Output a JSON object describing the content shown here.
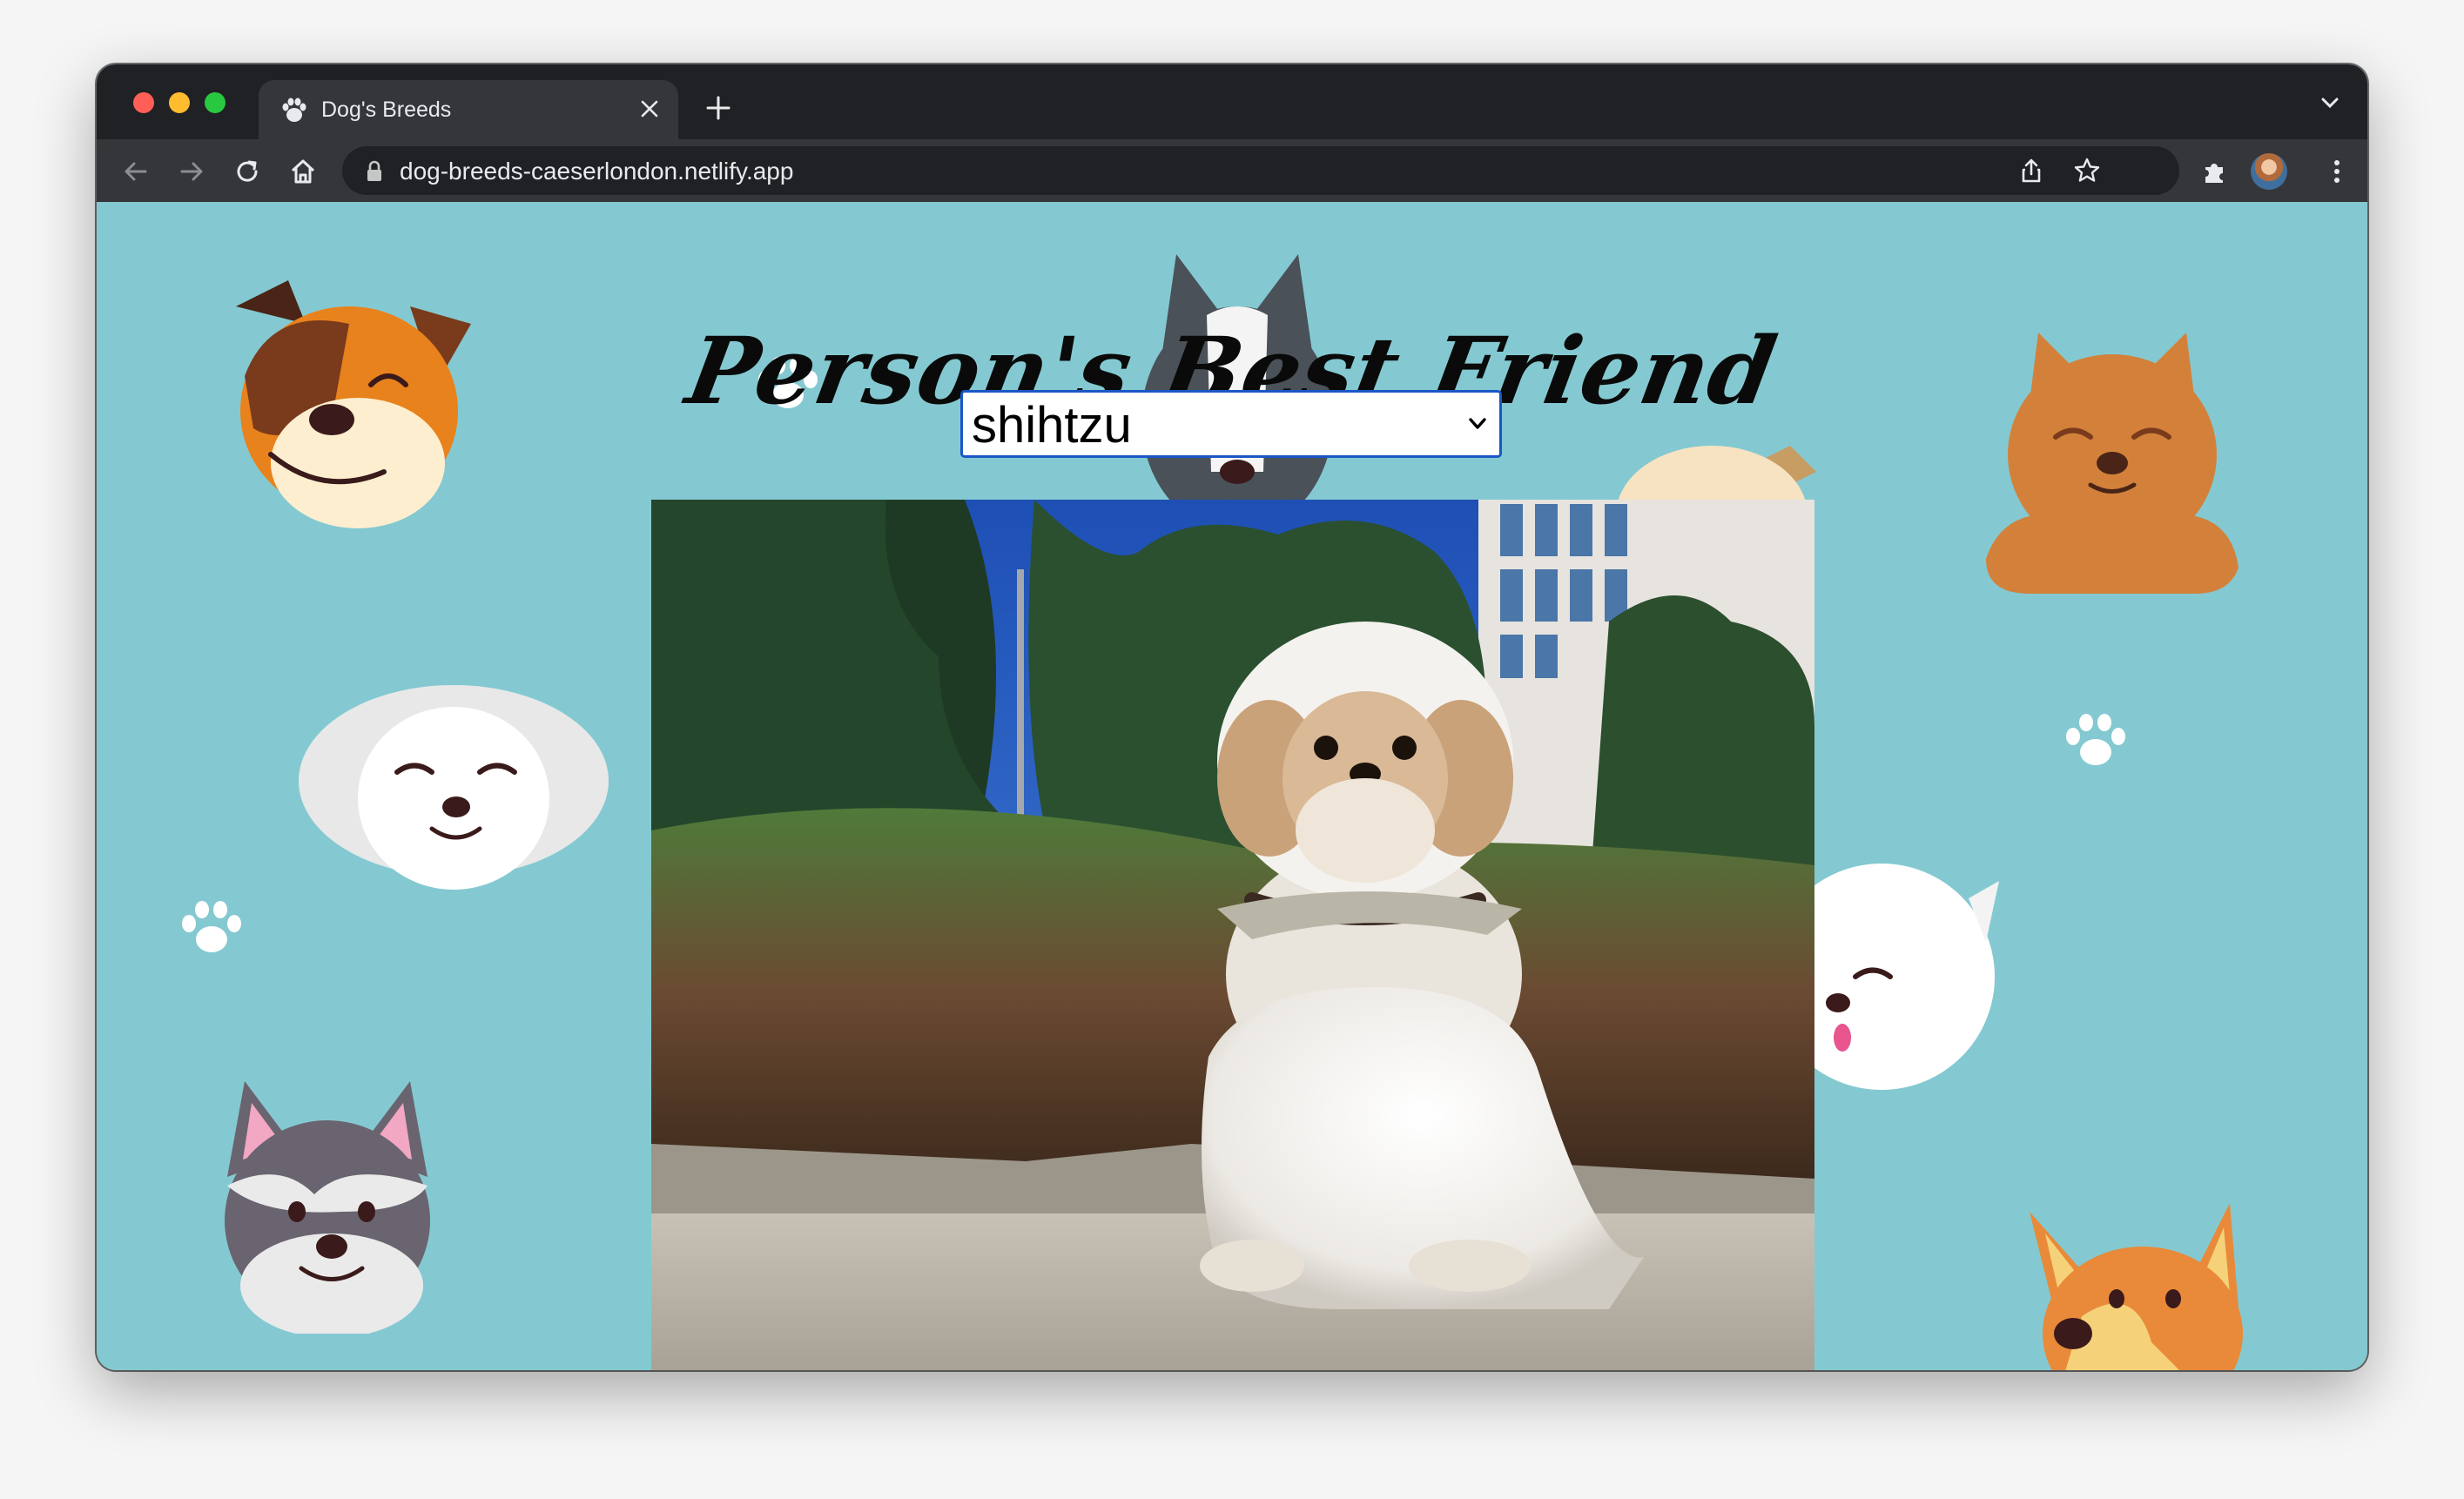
{
  "browser": {
    "tab": {
      "title": "Dog's Breeds"
    },
    "address_bar": {
      "url": "dog-breeds-caeserlondon.netlify.app"
    }
  },
  "page": {
    "title": "Person's Best Friend",
    "breed_select": {
      "selected": "shihtzu"
    }
  },
  "colors": {
    "page_background": "#84c9d1",
    "chrome_dark": "#202124",
    "chrome_toolbar": "#35363a",
    "select_focus_border": "#1a57c5"
  },
  "icons": [
    "paw-favicon-icon",
    "close-icon",
    "plus-icon",
    "chevron-down-icon",
    "back-arrow-icon",
    "forward-arrow-icon",
    "reload-icon",
    "home-icon",
    "lock-icon",
    "share-icon",
    "star-icon",
    "puzzle-extension-icon",
    "kebab-menu-icon"
  ]
}
